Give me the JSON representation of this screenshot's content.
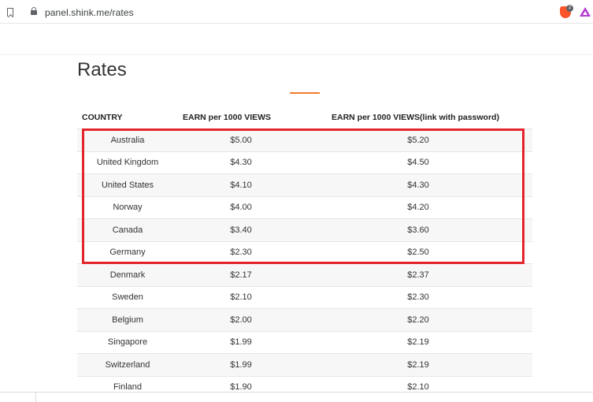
{
  "browser": {
    "url": "panel.shink.me/rates",
    "brave_badge_count": "2"
  },
  "page": {
    "title": "Rates"
  },
  "table": {
    "headers": [
      "COUNTRY",
      "EARN per 1000 VIEWS",
      "EARN per 1000 VIEWS(link with password)"
    ],
    "rows": [
      [
        "Australia",
        "$5.00",
        "$5.20"
      ],
      [
        "United Kingdom",
        "$4.30",
        "$4.50"
      ],
      [
        "United States",
        "$4.10",
        "$4.30"
      ],
      [
        "Norway",
        "$4.00",
        "$4.20"
      ],
      [
        "Canada",
        "$3.40",
        "$3.60"
      ],
      [
        "Germany",
        "$2.30",
        "$2.50"
      ],
      [
        "Denmark",
        "$2.17",
        "$2.37"
      ],
      [
        "Sweden",
        "$2.10",
        "$2.30"
      ],
      [
        "Belgium",
        "$2.00",
        "$2.20"
      ],
      [
        "Singapore",
        "$1.99",
        "$2.19"
      ],
      [
        "Switzerland",
        "$1.99",
        "$2.19"
      ],
      [
        "Finland",
        "$1.90",
        "$2.10"
      ]
    ]
  },
  "colors": {
    "accent": "#f07a2c",
    "highlight": "#e3242b",
    "stripe": "#f7f7f7"
  }
}
